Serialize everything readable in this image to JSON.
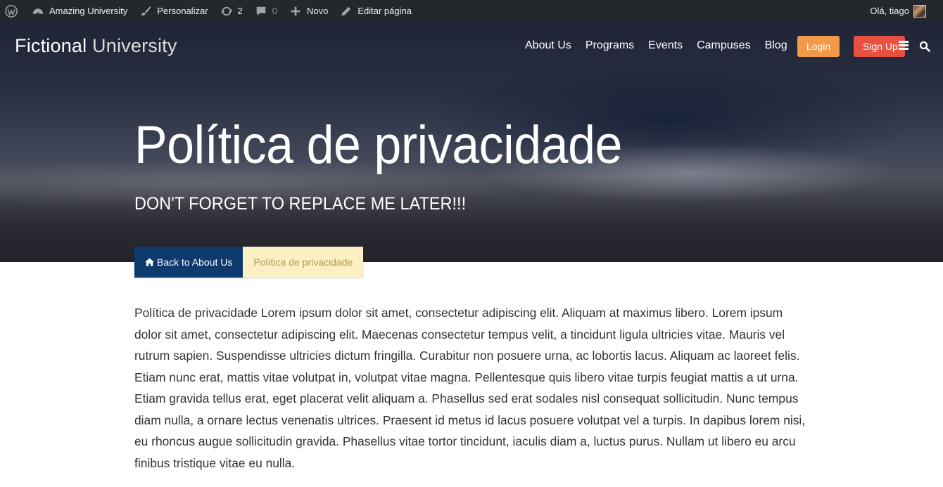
{
  "admin_bar": {
    "site_name": "Amazing University",
    "customize": "Personalizar",
    "updates_count": "2",
    "comments_count": "0",
    "new": "Novo",
    "edit_page": "Editar página",
    "greeting": "Olá, tiago"
  },
  "header": {
    "logo_strong": "Fictional",
    "logo_light": "University",
    "nav": [
      "About Us",
      "Programs",
      "Events",
      "Campuses",
      "Blog"
    ],
    "login": "Login",
    "signup": "Sign Up"
  },
  "hero": {
    "title": "Política de privacidade",
    "subtitle": "DON'T FORGET TO REPLACE ME LATER!!!"
  },
  "breadcrumb": {
    "parent": "Back to About Us",
    "current": "Política de privacidade"
  },
  "content": {
    "paragraph": "Política de privacidade Lorem ipsum dolor sit amet, consectetur adipiscing elit. Aliquam at maximus libero. Lorem ipsum dolor sit amet, consectetur adipiscing elit. Maecenas consectetur tempus velit, a tincidunt ligula ultricies vitae. Mauris vel rutrum sapien. Suspendisse ultricies dictum fringilla. Curabitur non posuere urna, ac lobortis lacus. Aliquam ac laoreet felis. Etiam nunc erat, mattis vitae volutpat in, volutpat vitae magna. Pellentesque quis libero vitae turpis feugiat mattis a ut urna. Etiam gravida tellus erat, eget placerat velit aliquam a. Phasellus sed erat sodales nisl consequat sollicitudin. Nunc tempus diam nulla, a ornare lectus venenatis ultrices. Praesent id metus id lacus posuere volutpat vel a turpis. In dapibus lorem nisi, eu rhoncus augue sollicitudin gravida. Phasellus vitae tortor tincidunt, iaculis diam a, luctus purus. Nullam ut libero eu arcu finibus tristique vitae eu nulla."
  },
  "icons": {
    "wp": "wordpress-logo-icon",
    "dashboard": "dashboard-icon",
    "brush": "paintbrush-icon",
    "updates": "refresh-icon",
    "comments": "comment-icon",
    "plus": "plus-icon",
    "edit": "pencil-icon",
    "home": "home-icon",
    "menu": "hamburger-menu-icon",
    "search": "search-icon"
  },
  "colors": {
    "admin_bar": "#23282d",
    "login_button": "#f2994a",
    "signup_button": "#e8513f",
    "breadcrumb_parent": "#0e3a6e",
    "breadcrumb_current_bg": "#faf0c4",
    "breadcrumb_current_text": "#b59b4c"
  }
}
